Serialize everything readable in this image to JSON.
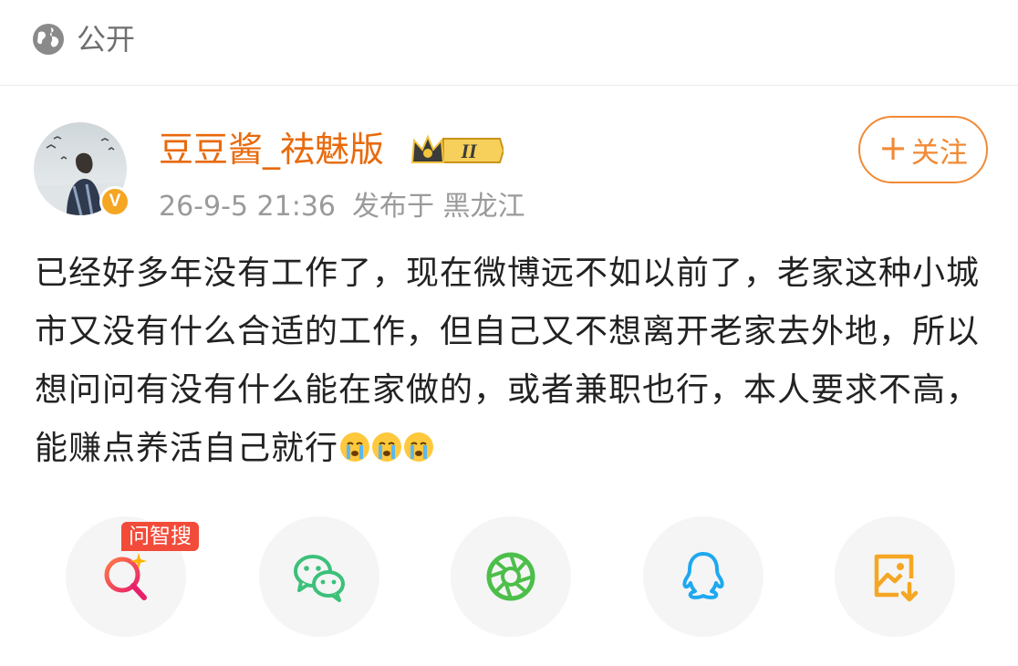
{
  "visibility": {
    "label": "公开",
    "icon": "globe-icon"
  },
  "post": {
    "author": {
      "name": "豆豆酱_祛魅版",
      "verified_badge": "V",
      "rank_badge_text": "II"
    },
    "meta": {
      "time": "26-9-5 21:36",
      "location": "发布于 黑龙江"
    },
    "follow_label": "关注",
    "text": "已经好多年没有工作了，现在微博远不如以前了，老家这种小城市又没有什么合适的工作，但自己又不想离开老家去外地，所以想问问有没有什么能在家做的，或者兼职也行，本人要求不高，能赚点养活自己就行",
    "emojis": [
      "crying-face-emoji",
      "crying-face-emoji",
      "crying-face-emoji"
    ]
  },
  "share": {
    "ai_search_tag": "问智搜",
    "buttons": [
      {
        "name": "ai-search-icon"
      },
      {
        "name": "wechat-icon"
      },
      {
        "name": "moments-icon"
      },
      {
        "name": "qq-icon"
      },
      {
        "name": "save-image-icon"
      }
    ]
  },
  "colors": {
    "accent": "#e86a0c",
    "follow": "#f08a36",
    "tag": "#f24b3a"
  }
}
